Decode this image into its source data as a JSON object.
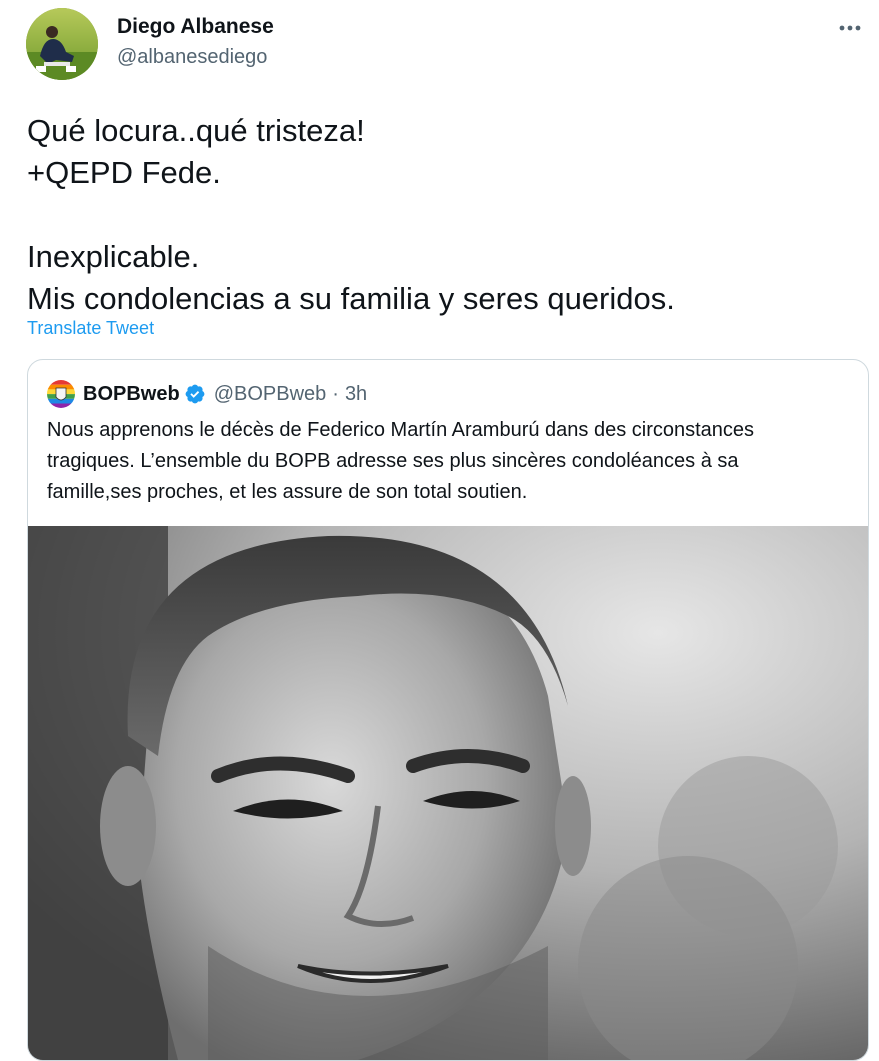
{
  "tweet": {
    "author_name": "Diego Albanese",
    "author_handle": "@albanesediego",
    "text_lines": [
      "Qué locura..qué tristeza!",
      "+QEPD Fede.",
      "",
      "Inexplicable.",
      "Mis condolencias a su familia y seres queridos."
    ],
    "translate_label": "Translate Tweet",
    "more_icon": "ellipsis-icon"
  },
  "quote": {
    "author_name": "BOPBweb",
    "author_handle": "@BOPBweb",
    "separator": "·",
    "time": "3h",
    "verified_icon": "verified-badge-icon",
    "text_lines": [
      "Nous apprenons le décès de Federico Martín Aramburú dans des circonstances",
      "tragiques. L’ensemble du BOPB adresse ses plus sincères condoléances à sa",
      "famille,ses proches, et les assure de son total soutien."
    ]
  },
  "colors": {
    "text": "#0f1419",
    "secondary": "#536471",
    "link": "#1d9bf0",
    "border": "#cfd9de"
  }
}
